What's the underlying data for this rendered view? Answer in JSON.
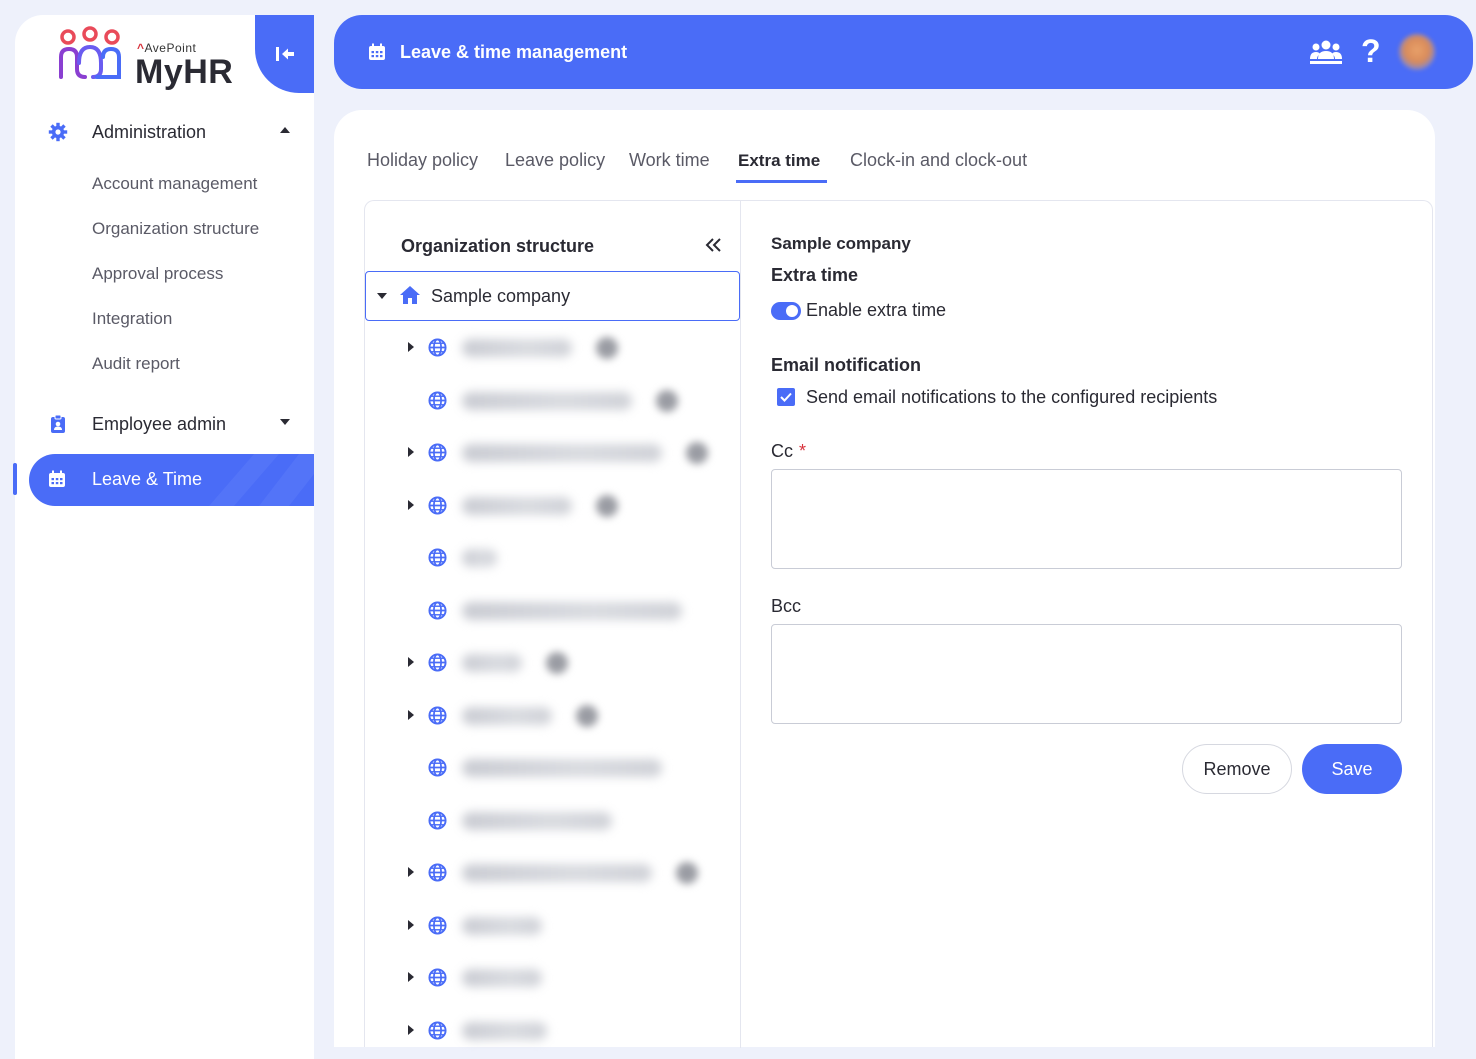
{
  "app": {
    "brand_prefix": "AvePoint",
    "brand_name": "MyHR"
  },
  "sidebar": {
    "sections": [
      {
        "label": "Administration",
        "icon": "gear-icon",
        "expanded": true,
        "items": [
          "Account management",
          "Organization structure",
          "Approval process",
          "Integration",
          "Audit report"
        ]
      },
      {
        "label": "Employee admin",
        "icon": "badge-icon",
        "expanded": false
      }
    ],
    "active_item": {
      "label": "Leave & Time",
      "icon": "calendar-icon"
    }
  },
  "header": {
    "title": "Leave & time management",
    "icons": [
      "calendar-icon",
      "people-icon",
      "help-icon",
      "avatar"
    ]
  },
  "tabs": [
    {
      "label": "Holiday policy",
      "active": false
    },
    {
      "label": "Leave policy",
      "active": false
    },
    {
      "label": "Work time",
      "active": false
    },
    {
      "label": "Extra time",
      "active": true
    },
    {
      "label": "Clock-in and clock-out",
      "active": false
    }
  ],
  "tree": {
    "title": "Organization structure",
    "root": "Sample company",
    "nodes": [
      {
        "expandable": true
      },
      {
        "expandable": false
      },
      {
        "expandable": true
      },
      {
        "expandable": true
      },
      {
        "expandable": false
      },
      {
        "expandable": false
      },
      {
        "expandable": true
      },
      {
        "expandable": true
      },
      {
        "expandable": false
      },
      {
        "expandable": false
      },
      {
        "expandable": true
      },
      {
        "expandable": true
      },
      {
        "expandable": true
      },
      {
        "expandable": true
      }
    ]
  },
  "form": {
    "org_name": "Sample company",
    "section_title": "Extra time",
    "toggle": {
      "label": "Enable extra time",
      "on": true
    },
    "email_title": "Email notification",
    "checkbox": {
      "label": "Send email notifications to the configured recipients",
      "checked": true
    },
    "cc_label": "Cc",
    "cc_required_mark": "*",
    "cc_value": "",
    "bcc_label": "Bcc",
    "bcc_value": "",
    "remove_label": "Remove",
    "save_label": "Save"
  },
  "colors": {
    "accent": "#4a6cf7",
    "background": "#eef1fb",
    "required": "#d8323c"
  }
}
